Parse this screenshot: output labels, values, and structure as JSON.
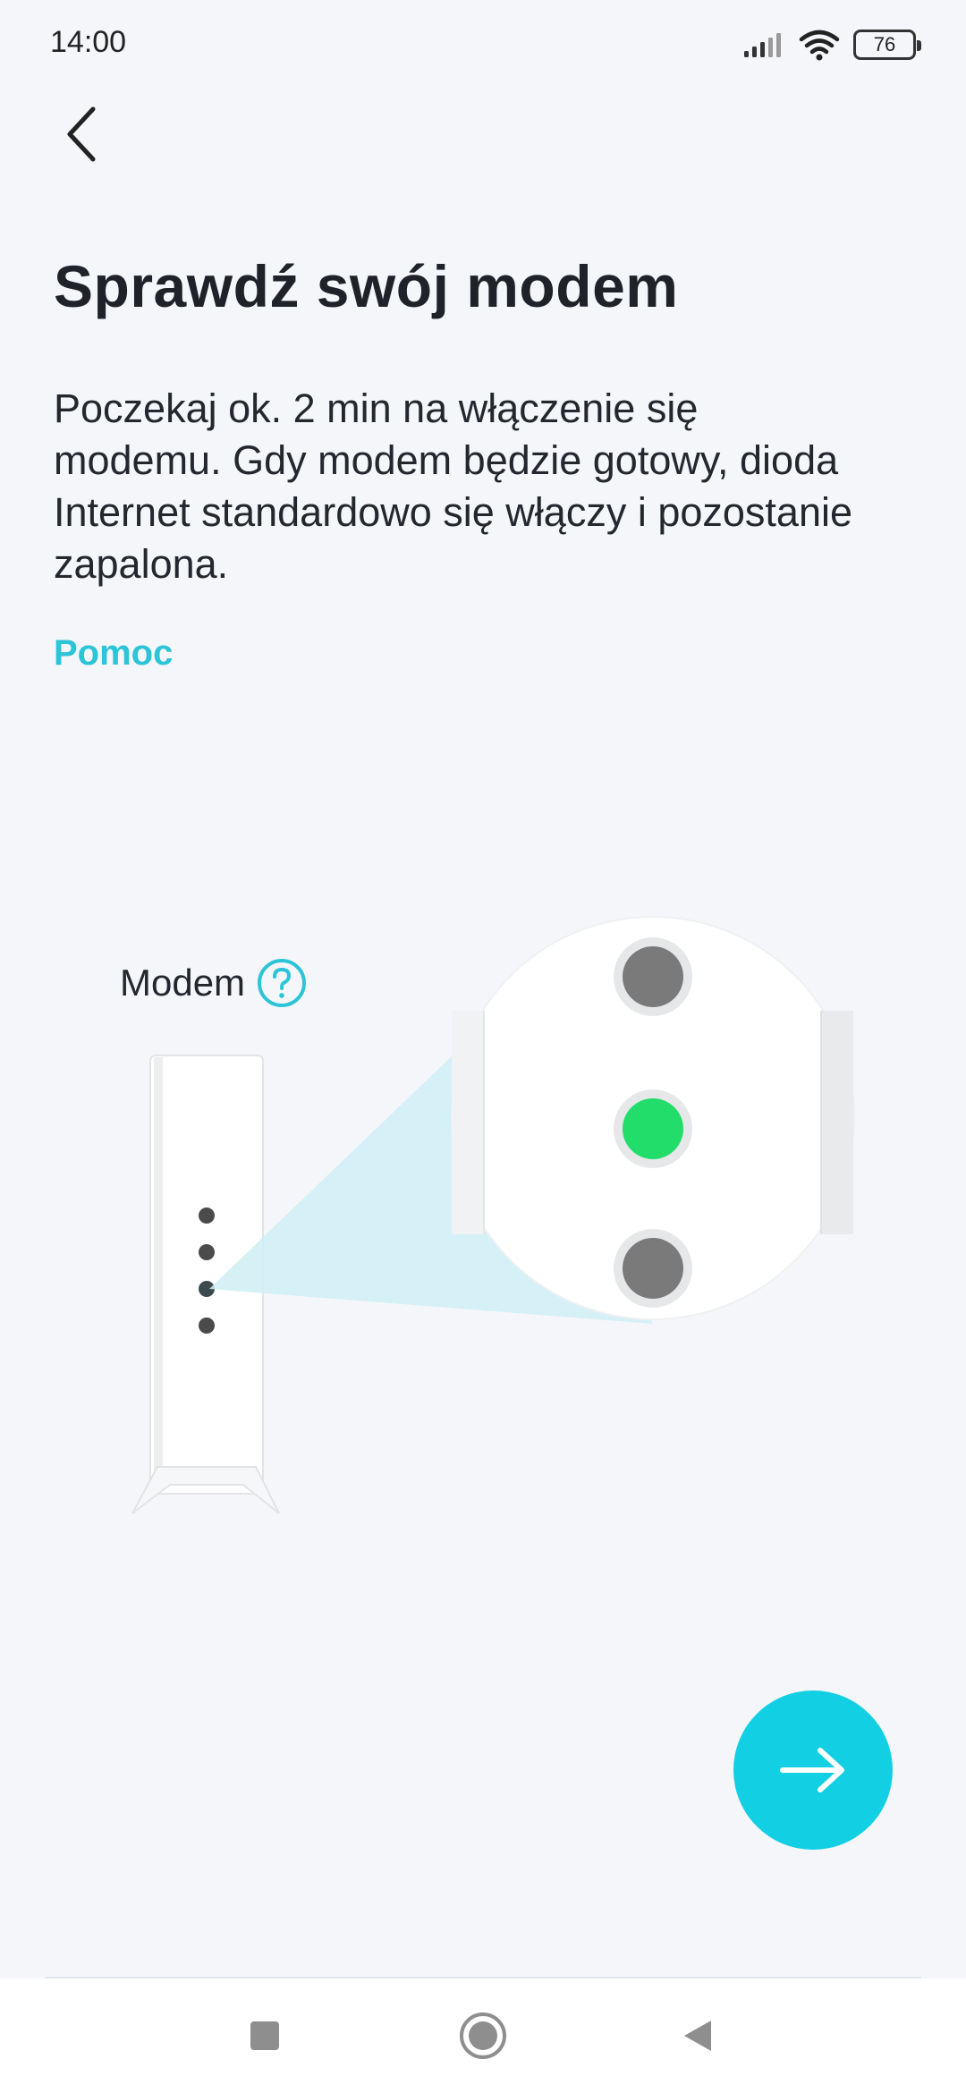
{
  "status_bar": {
    "time": "14:00",
    "battery": "76",
    "icons": [
      "signal-icon",
      "wifi-icon",
      "battery-icon"
    ]
  },
  "header": {
    "back_icon": "chevron-left-icon"
  },
  "content": {
    "title": "Sprawdź swój modem",
    "description": "Poczekaj ok. 2 min na włączenie się modemu. Gdy modem będzie gotowy, dioda Internet standardowo się włączy i pozostanie zapalona.",
    "help_link": "Pomoc"
  },
  "illustration": {
    "modem_label": "Modem",
    "help_icon": "question-circle-icon",
    "led_states": [
      "off",
      "on",
      "off"
    ],
    "colors": {
      "led_on": "#22dd6a",
      "led_off": "#7a7a7a",
      "zoom_beam": "#cfeef5"
    }
  },
  "actions": {
    "next_icon": "arrow-right-icon"
  },
  "nav_bar": {
    "items": [
      "recents-square-icon",
      "home-circle-icon",
      "back-triangle-icon"
    ]
  },
  "colors": {
    "accent": "#12cfe3",
    "link": "#2cc4d7",
    "background": "#f4f6fa"
  }
}
